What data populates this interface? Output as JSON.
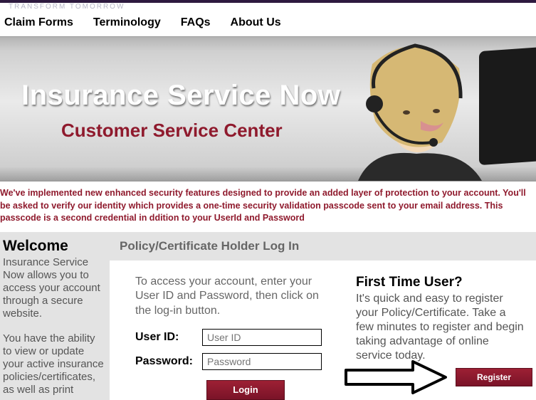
{
  "tagline": "TRANSFORM TOMORROW",
  "nav": {
    "claim_forms": "Claim Forms",
    "terminology": "Terminology",
    "faqs": "FAQs",
    "about_us": "About Us"
  },
  "hero": {
    "title": "Insurance Service Now",
    "subtitle": "Customer Service Center"
  },
  "alert": "We've implemented new enhanced security features designed to provide an added layer of protection to your account. You'll be asked to verify our identity which provides a one-time security validation passcode sent to your email address. This passcode is a second credential in ddition to your UserId and Password",
  "sidebar": {
    "heading": "Welcome",
    "p1": "Insurance Service Now allows you to access your account through a secure website.",
    "p2": "You have the ability to view or update your active insurance policies/certificates, as well as print"
  },
  "content": {
    "header": "Policy/Certificate Holder Log In",
    "login": {
      "intro": "To access your account, enter your User ID and Password, then click on the log-in button.",
      "userid_label": "User ID:",
      "userid_placeholder": "User ID",
      "password_label": "Password:",
      "password_placeholder": "Password",
      "login_btn": "Login"
    },
    "register": {
      "heading": "First Time User?",
      "text": "It's quick and easy to register your Policy/Certificate. Take a few minutes to register and begin taking advantage of online service today.",
      "register_btn": "Register"
    }
  }
}
